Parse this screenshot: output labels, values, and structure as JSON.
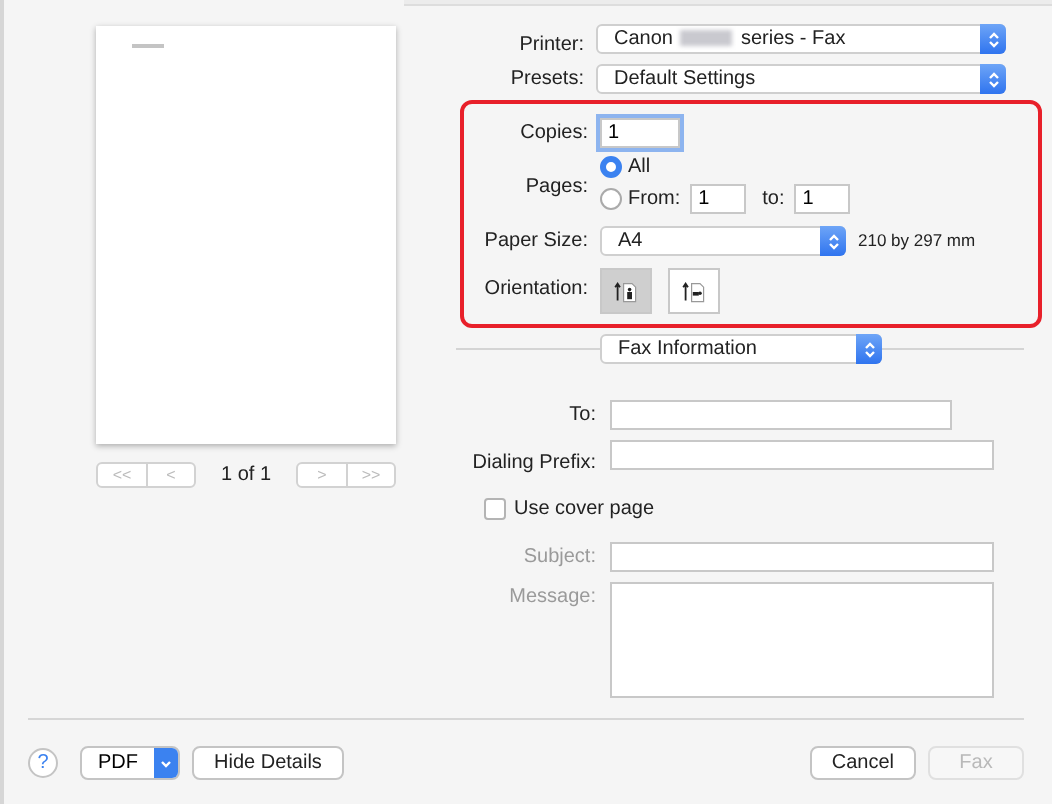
{
  "preview": {
    "page_indicator": "1 of 1",
    "nav_groups": [
      [
        {
          "label": "<<",
          "disabled": true
        },
        {
          "label": "<",
          "disabled": true
        }
      ],
      [
        {
          "label": ">",
          "disabled": true
        },
        {
          "label": ">>",
          "disabled": true
        }
      ]
    ]
  },
  "printer": {
    "label": "Printer:",
    "value_start": "Canon",
    "value_end": "series - Fax",
    "redacted": true
  },
  "presets": {
    "label": "Presets:",
    "value": "Default Settings"
  },
  "highlight": {
    "on": true,
    "copies": {
      "label": "Copies:",
      "value": "1",
      "focused": true
    },
    "pages": {
      "label": "Pages:",
      "options": [
        {
          "label": "All",
          "selected": true
        },
        {
          "label": "From:",
          "selected": false
        }
      ],
      "from": "1",
      "to_label": "to:",
      "to": "1"
    },
    "paper_size": {
      "label": "Paper Size:",
      "value": "A4",
      "dimensions": "210 by 297 mm"
    },
    "orientation": {
      "label": "Orientation:",
      "options": [
        {
          "kind": "portrait",
          "selected": true
        },
        {
          "kind": "landscape",
          "selected": false
        }
      ]
    }
  },
  "pane": {
    "value": "Fax Information"
  },
  "fax": {
    "fields": [
      {
        "label": "To:",
        "kind": "short",
        "disabled": false
      },
      {
        "label": "Dialing Prefix:",
        "kind": "long",
        "disabled": false
      }
    ],
    "cover_page": {
      "label": "Use cover page",
      "checked": false
    },
    "cover_fields": [
      {
        "label": "Subject:",
        "kind": "line",
        "disabled": true
      },
      {
        "label": "Message:",
        "kind": "area",
        "disabled": true
      }
    ]
  },
  "footer": {
    "help": "?",
    "pdf": "PDF",
    "left_buttons": [
      {
        "label": "Hide Details",
        "disabled": false
      }
    ],
    "right_buttons": [
      {
        "label": "Cancel",
        "disabled": false
      },
      {
        "label": "Fax",
        "disabled": true
      }
    ]
  }
}
